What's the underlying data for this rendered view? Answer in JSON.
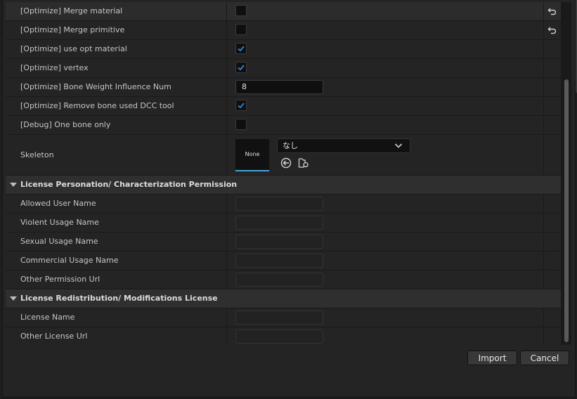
{
  "rows_top": [
    {
      "label": "[Optimize] Merge material",
      "type": "checkbox",
      "checked": false,
      "reset": true,
      "highlight": true
    },
    {
      "label": "[Optimize] Merge primitive",
      "type": "checkbox",
      "checked": false,
      "reset": true
    },
    {
      "label": "[Optimize] use opt material",
      "type": "checkbox",
      "checked": true
    },
    {
      "label": "[Optimize] vertex",
      "type": "checkbox",
      "checked": true
    },
    {
      "label": "[Optimize] Bone Weight Influence Num",
      "type": "number",
      "value": "8"
    },
    {
      "label": "[Optimize] Remove bone used DCC tool",
      "type": "checkbox",
      "checked": true
    },
    {
      "label": "[Debug] One bone only",
      "type": "checkbox",
      "checked": false
    }
  ],
  "skeleton": {
    "label": "Skeleton",
    "thumb_text": "None",
    "dropdown_value": "なし"
  },
  "category_personation": {
    "label": "License Personation/ Characterization Permission",
    "rows": [
      {
        "label": "Allowed User Name",
        "value": ""
      },
      {
        "label": "Violent Usage Name",
        "value": ""
      },
      {
        "label": "Sexual Usage Name",
        "value": ""
      },
      {
        "label": "Commercial Usage Name",
        "value": ""
      },
      {
        "label": "Other Permission Url",
        "value": ""
      }
    ]
  },
  "category_redistribution": {
    "label": "License Redistribution/ Modifications License",
    "rows": [
      {
        "label": "License Name",
        "value": ""
      },
      {
        "label": "Other License Url",
        "value": ""
      }
    ]
  },
  "buttons": {
    "import_label": "Import",
    "cancel_label": "Cancel"
  },
  "colors": {
    "check": "#2f7fd0",
    "accent": "#4aa3d8"
  }
}
